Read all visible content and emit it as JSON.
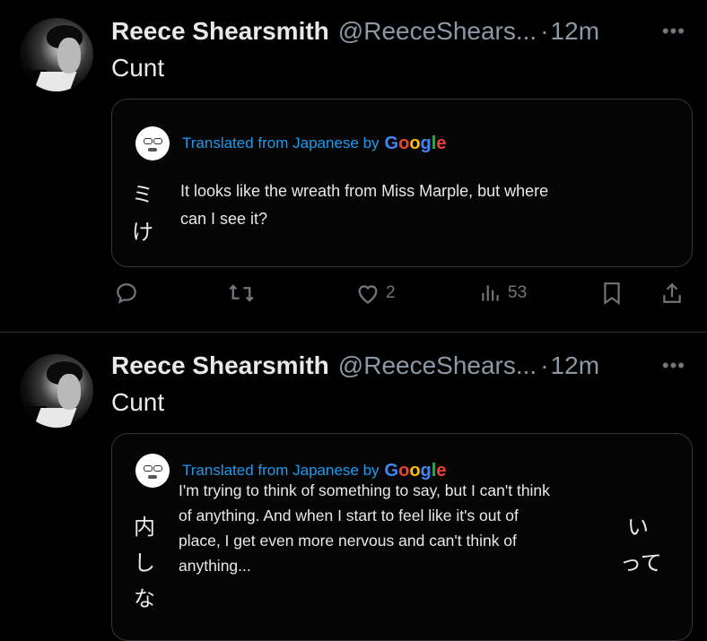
{
  "tweets": [
    {
      "author": {
        "name": "Reece Shearsmith",
        "handle": "@ReeceShears...",
        "time": "12m"
      },
      "more_label": "•••",
      "text": "Cunt",
      "quote": {
        "translated_by": "Translated from Japanese by",
        "google": [
          "G",
          "o",
          "o",
          "g",
          "l",
          "e"
        ],
        "original_fragments": [
          "ミ",
          "け"
        ],
        "translation_lines": [
          "It looks like the wreath from Miss Marple, but where",
          "can I see it?"
        ]
      },
      "actions": {
        "likes": "2",
        "views": "53"
      }
    },
    {
      "author": {
        "name": "Reece Shearsmith",
        "handle": "@ReeceShears...",
        "time": "12m"
      },
      "more_label": "•••",
      "text": "Cunt",
      "quote": {
        "translated_by": "Translated from Japanese by",
        "google": [
          "G",
          "o",
          "o",
          "g",
          "l",
          "e"
        ],
        "original_fragments": [
          "内",
          "し",
          "な",
          "い",
          "って"
        ],
        "translation_lines": [
          "I'm trying to think of something to say, but I can't think",
          "of anything. And when I start to feel like it's out of",
          "place, I get even more nervous and can't think of",
          "anything..."
        ]
      }
    }
  ],
  "colors": {
    "background": "#000000",
    "text": "#e7e9ea",
    "muted": "#71767b",
    "link": "#1d9bf0"
  },
  "icons": [
    "reply-icon",
    "retweet-icon",
    "like-icon",
    "views-icon",
    "bookmark-icon",
    "share-icon"
  ]
}
